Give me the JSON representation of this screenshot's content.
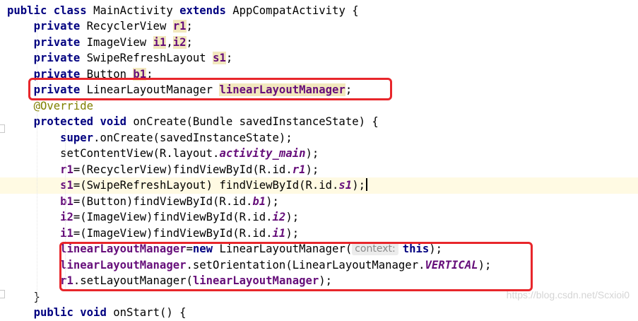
{
  "code_lines": [
    [
      {
        "t": "public class ",
        "c": "kw"
      },
      {
        "t": "MainActivity "
      },
      {
        "t": "extends ",
        "c": "kw"
      },
      {
        "t": "AppCompatActivity {"
      }
    ],
    [
      {
        "t": "    "
      },
      {
        "t": "private ",
        "c": "kw"
      },
      {
        "t": "RecyclerView "
      },
      {
        "t": "r1",
        "c": "fld mark"
      },
      {
        "t": ";"
      }
    ],
    [
      {
        "t": "    "
      },
      {
        "t": "private ",
        "c": "kw"
      },
      {
        "t": "ImageView "
      },
      {
        "t": "i1",
        "c": "fld mark"
      },
      {
        "t": ","
      },
      {
        "t": "i2",
        "c": "fld mark"
      },
      {
        "t": ";"
      }
    ],
    [
      {
        "t": "    "
      },
      {
        "t": "private ",
        "c": "kw"
      },
      {
        "t": "SwipeRefreshLayout "
      },
      {
        "t": "s1",
        "c": "fld mark"
      },
      {
        "t": ";"
      }
    ],
    [
      {
        "t": "    "
      },
      {
        "t": "private ",
        "c": "kw"
      },
      {
        "t": "Button "
      },
      {
        "t": "b1",
        "c": "fld mark"
      },
      {
        "t": ";"
      }
    ],
    [
      {
        "t": "    "
      },
      {
        "t": "private ",
        "c": "kw"
      },
      {
        "t": "LinearLayoutManager "
      },
      {
        "t": "linearLayoutManager",
        "c": "fld mark"
      },
      {
        "t": ";"
      }
    ],
    [
      {
        "t": "    "
      },
      {
        "t": "@Override",
        "c": "ann"
      }
    ],
    [
      {
        "t": "    "
      },
      {
        "t": "protected void ",
        "c": "kw"
      },
      {
        "t": "onCreate(Bundle savedInstanceState) {"
      }
    ],
    [
      {
        "t": "        "
      },
      {
        "t": "super",
        "c": "kw"
      },
      {
        "t": ".onCreate(savedInstanceState);"
      }
    ],
    [
      {
        "t": "        setContentView(R.layout."
      },
      {
        "t": "activity_main",
        "c": "fldi"
      },
      {
        "t": ");"
      }
    ],
    [
      {
        "t": "        "
      },
      {
        "t": "r1",
        "c": "fld"
      },
      {
        "t": "=(RecyclerView)findViewById(R.id."
      },
      {
        "t": "r1",
        "c": "fldi"
      },
      {
        "t": ");"
      }
    ],
    [
      {
        "t": "        "
      },
      {
        "t": "s1",
        "c": "fld"
      },
      {
        "t": "=(SwipeRefreshLayout) findViewById(R.id."
      },
      {
        "t": "s1",
        "c": "fldi"
      },
      {
        "t": ");"
      },
      {
        "t": "",
        "c": "caret"
      }
    ],
    [
      {
        "t": "        "
      },
      {
        "t": "b1",
        "c": "fld"
      },
      {
        "t": "=(Button)findViewById(R.id."
      },
      {
        "t": "b1",
        "c": "fldi"
      },
      {
        "t": ");"
      }
    ],
    [
      {
        "t": "        "
      },
      {
        "t": "i2",
        "c": "fld"
      },
      {
        "t": "=(ImageView)findViewById(R.id."
      },
      {
        "t": "i2",
        "c": "fldi"
      },
      {
        "t": ");"
      }
    ],
    [
      {
        "t": "        "
      },
      {
        "t": "i1",
        "c": "fld"
      },
      {
        "t": "=(ImageView)findViewById(R.id."
      },
      {
        "t": "i1",
        "c": "fldi"
      },
      {
        "t": ");"
      }
    ],
    [
      {
        "t": "        "
      },
      {
        "t": "linearLayoutManager",
        "c": "fld"
      },
      {
        "t": "="
      },
      {
        "t": "new ",
        "c": "kw"
      },
      {
        "t": "LinearLayoutManager("
      },
      {
        "t": "context:",
        "c": "hint"
      },
      {
        "t": "this",
        "c": "kw"
      },
      {
        "t": ");"
      }
    ],
    [
      {
        "t": "        "
      },
      {
        "t": "linearLayoutManager",
        "c": "fld"
      },
      {
        "t": ".setOrientation(LinearLayoutManager."
      },
      {
        "t": "VERTICAL",
        "c": "fldi"
      },
      {
        "t": ");"
      }
    ],
    [
      {
        "t": "        "
      },
      {
        "t": "r1",
        "c": "fld"
      },
      {
        "t": ".setLayoutManager("
      },
      {
        "t": "linearLayoutManager",
        "c": "fld"
      },
      {
        "t": ");"
      }
    ],
    [
      {
        "t": "    }"
      }
    ],
    [
      {
        "t": "    "
      },
      {
        "t": "public void ",
        "c": "kw"
      },
      {
        "t": "onStart() {"
      }
    ]
  ],
  "highlighted_line": 11,
  "watermark": "https://blog.csdn.net/Scxioi0",
  "colors": {
    "keyword": "#000080",
    "field": "#660e7a",
    "annotation": "#808000",
    "annotation_box": "#e8262b",
    "current_line": "#fffae3",
    "usage_highlight": "#f2e8bd"
  }
}
